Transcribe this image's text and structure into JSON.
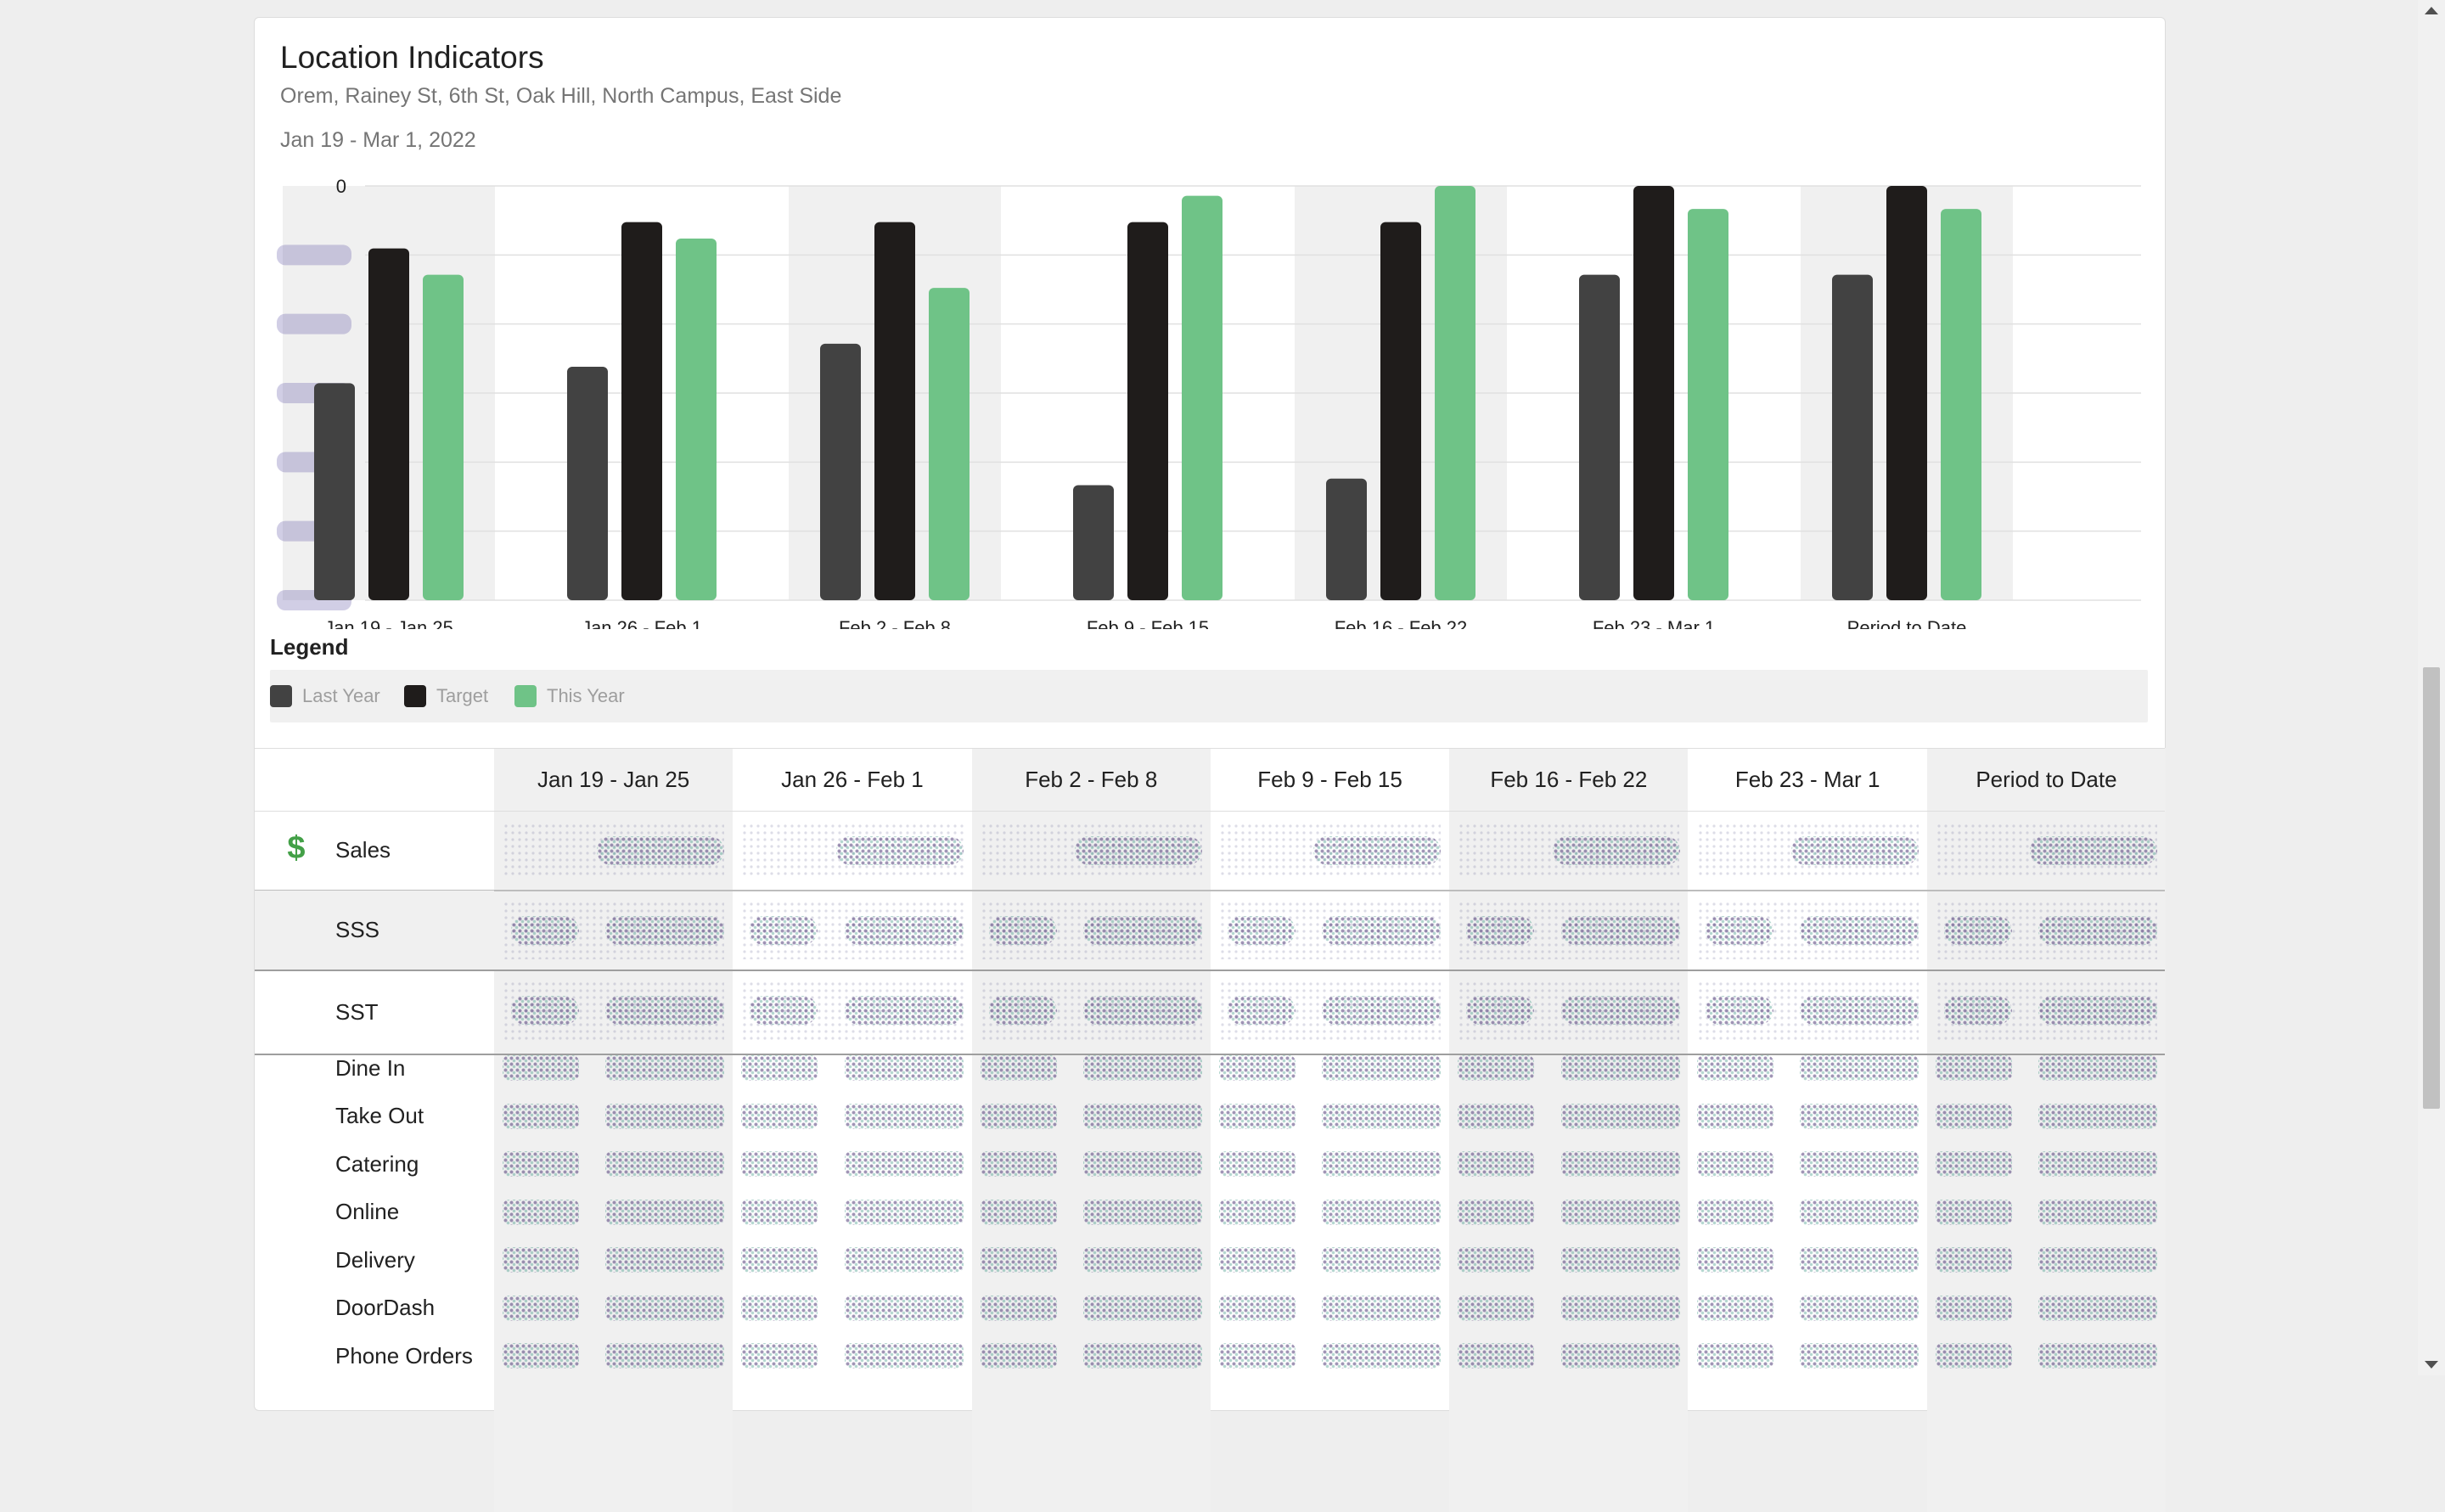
{
  "card": {
    "title": "Location Indicators",
    "subtitle": "Orem, Rainey St, 6th St, Oak Hill, North Campus, East Side",
    "date_range": "Jan 19 - Mar 1, 2022"
  },
  "chart_data": {
    "type": "bar",
    "categories": [
      "Jan 19 - Jan 25",
      "Jan 26 - Feb 1",
      "Feb 2 - Feb 8",
      "Feb 9 - Feb 15",
      "Feb 16 - Feb 22",
      "Feb 23 - Mar 1",
      "Period to Date"
    ],
    "series": [
      {
        "name": "Last Year",
        "color": "#424242",
        "values": [
          3.3,
          3.55,
          3.9,
          1.75,
          1.85,
          4.95,
          4.95
        ]
      },
      {
        "name": "Target",
        "color": "#1f1c1b",
        "values": [
          5.35,
          5.75,
          5.75,
          5.75,
          5.75,
          6.3,
          6.3
        ]
      },
      {
        "name": "This Year",
        "color": "#6fc387",
        "values": [
          4.95,
          5.5,
          4.75,
          6.15,
          6.3,
          5.95,
          5.95
        ]
      }
    ],
    "ylim": [
      0,
      6.3
    ],
    "y_ticks": [
      "0",
      "",
      "",
      "",
      "",
      "",
      ""
    ],
    "grid": true,
    "legend_placement": "bottom"
  },
  "legend": {
    "title": "Legend",
    "items": [
      {
        "label": "Last Year",
        "color": "#424242"
      },
      {
        "label": "Target",
        "color": "#1f1c1b"
      },
      {
        "label": "This Year",
        "color": "#6fc387"
      }
    ]
  },
  "table": {
    "columns": [
      "Jan 19 - Jan 25",
      "Jan 26 - Feb 1",
      "Feb 2 - Feb 8",
      "Feb 9 - Feb 15",
      "Feb 16 - Feb 22",
      "Feb 23 - Mar 1",
      "Period to Date"
    ],
    "rows": [
      {
        "label": "Sales",
        "icon": "dollar-icon"
      },
      {
        "label": "SSS",
        "icon": ""
      },
      {
        "label": "SST",
        "icon": ""
      }
    ],
    "channel_rows": [
      "Dine In",
      "Take Out",
      "Catering",
      "Online",
      "Delivery",
      "DoorDash",
      "Phone Orders"
    ],
    "colors": {
      "shaded_column": "#f0f0f0",
      "accent": "#43a047"
    }
  }
}
